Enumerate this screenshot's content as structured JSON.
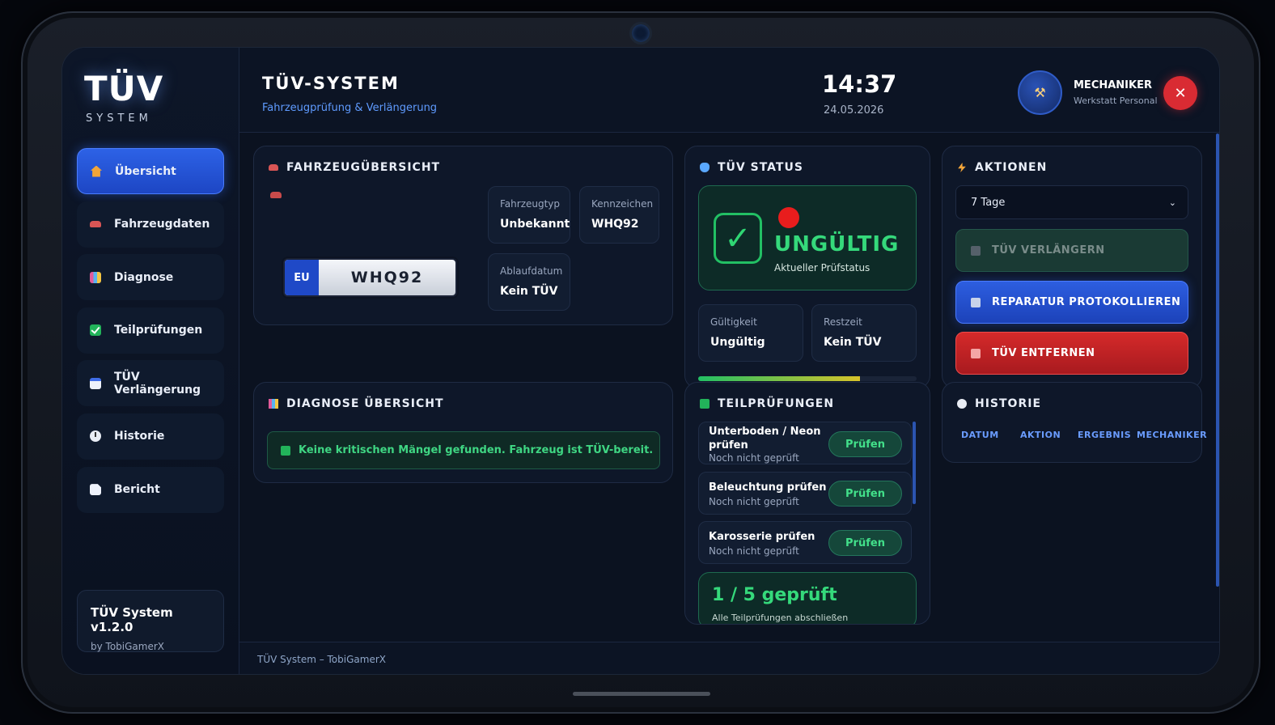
{
  "logo": {
    "main": "TÜV",
    "sub": "SYSTEM"
  },
  "sidebar": {
    "items": [
      {
        "label": "Übersicht",
        "icon": "home-icon",
        "active": true
      },
      {
        "label": "Fahrzeugdaten",
        "icon": "car-icon"
      },
      {
        "label": "Diagnose",
        "icon": "chart-icon"
      },
      {
        "label": "Teilprüfungen",
        "icon": "checkbox-icon"
      },
      {
        "label": "TÜV Verlängerung",
        "icon": "calendar-icon"
      },
      {
        "label": "Historie",
        "icon": "clock-icon"
      },
      {
        "label": "Bericht",
        "icon": "document-icon"
      }
    ],
    "version": {
      "title": "TÜV System v1.2.0",
      "author": "by TobiGamerX"
    }
  },
  "header": {
    "title": "TÜV-SYSTEM",
    "subtitle": "Fahrzeugprüfung & Verlängerung",
    "time": "14:37",
    "date": "24.05.2026",
    "role": "MECHANIKER",
    "role_sub": "Werkstatt Personal",
    "avatar_icon": "tools-icon",
    "close_label": "✕"
  },
  "vehicle": {
    "title": "FAHRZEUGÜBERSICHT",
    "plate_country": "EU",
    "plate_number": "WHQ92",
    "type_label": "Fahrzeugtyp",
    "type_value": "Unbekannt",
    "plate_label": "Kennzeichen",
    "plate_value": "WHQ92",
    "expiry_label": "Ablaufdatum",
    "expiry_value": "Kein TÜV"
  },
  "status": {
    "title": "TÜV STATUS",
    "state": "UNGÜLTIG",
    "state_sub": "Aktueller Prüfstatus",
    "check_mark": "✓",
    "validity_label": "Gültigkeit",
    "validity_value": "Ungültig",
    "remaining_label": "Restzeit",
    "remaining_value": "Kein TÜV",
    "progress": 0.74,
    "status_color": "#e81d1d"
  },
  "actions": {
    "title": "AKTIONEN",
    "period": "7 Tage",
    "extend_label": "TÜV VERLÄNGERN",
    "repair_label": "REPARATUR PROTOKOLLIEREN",
    "remove_label": "TÜV ENTFERNEN"
  },
  "diagnosis": {
    "title": "DIAGNOSE ÜBERSICHT",
    "message": "Keine kritischen Mängel gefunden. Fahrzeug ist TÜV-bereit."
  },
  "subchecks": {
    "title": "TEILPRÜFUNGEN",
    "items": [
      {
        "name": "Unterboden / Neon prüfen",
        "state": "Noch nicht geprüft",
        "button": "Prüfen"
      },
      {
        "name": "Beleuchtung prüfen",
        "state": "Noch nicht geprüft",
        "button": "Prüfen"
      },
      {
        "name": "Karosserie prüfen",
        "state": "Noch nicht geprüft",
        "button": "Prüfen"
      }
    ],
    "count": "1 / 5 geprüft",
    "count_sub": "Alle Teilprüfungen abschließen"
  },
  "history": {
    "title": "HISTORIE",
    "columns": [
      "DATUM",
      "AKTION",
      "ERGEBNIS",
      "MECHANIKER"
    ]
  },
  "footer": {
    "text": "TÜV System – TobiGamerX"
  }
}
